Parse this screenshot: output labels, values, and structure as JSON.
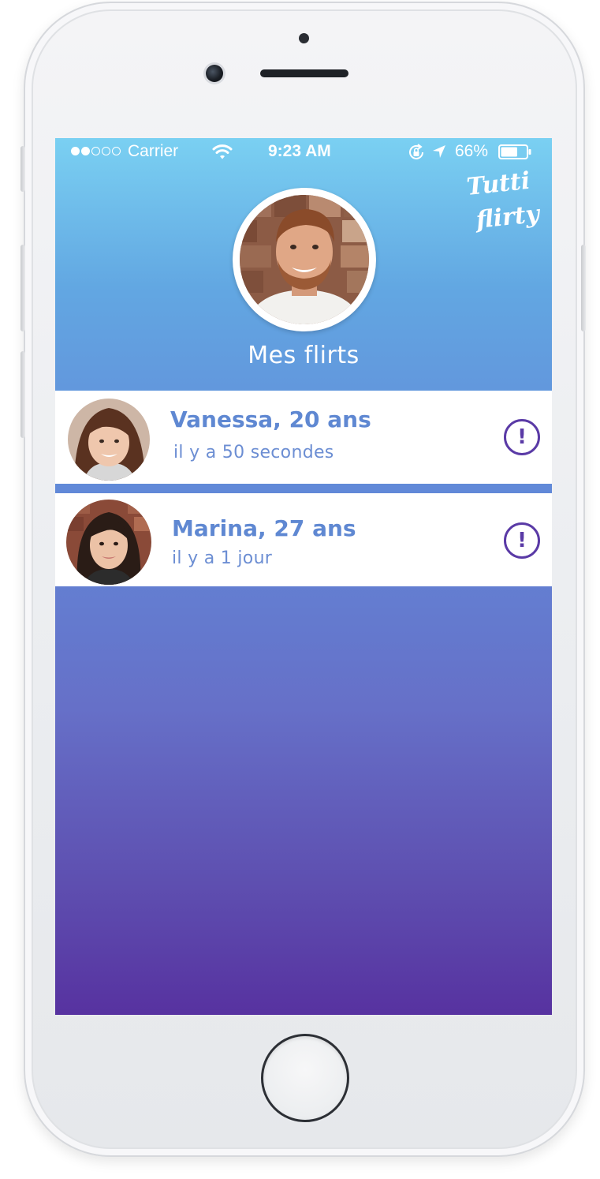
{
  "status_bar": {
    "signal_full": 2,
    "signal_total": 5,
    "carrier": "Carrier",
    "time": "9:23 AM",
    "battery": "66%",
    "battery_level": 0.66,
    "icons": [
      "wifi-icon",
      "rotation-lock-icon",
      "location-arrow-icon",
      "battery-icon"
    ]
  },
  "brand": {
    "logo_line1": "Tutti",
    "logo_line2": "flirty"
  },
  "header": {
    "title": "Mes flirts"
  },
  "flirts": [
    {
      "name": "Vanessa, 20 ans",
      "time": "il y a 50 secondes",
      "action_icon": "exclamation-icon",
      "action_label": "!"
    },
    {
      "name": "Marina, 27 ans",
      "time": "il y a 1 jour",
      "action_icon": "exclamation-icon",
      "action_label": "!"
    }
  ],
  "colors": {
    "gradient_top": "#7ad0f2",
    "gradient_bottom": "#5732a0",
    "name_blue": "#5f88d2",
    "alert_purple": "#5a3aa6"
  }
}
